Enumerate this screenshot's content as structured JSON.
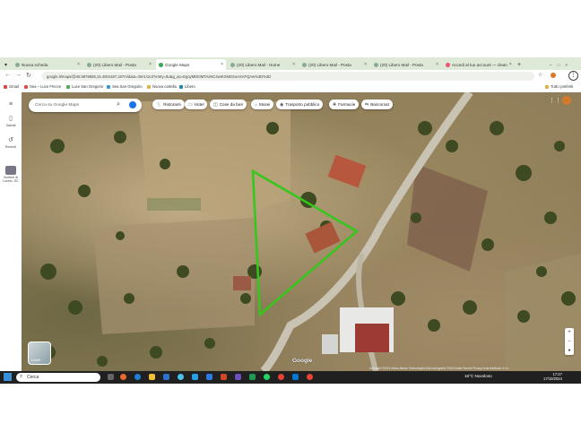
{
  "tabs": [
    {
      "label": "Nuova scheda"
    },
    {
      "label": "(20) Libero Mail - Posta"
    },
    {
      "label": "Google Maps"
    },
    {
      "label": "(20) Libero Mail - Home"
    },
    {
      "label": "(20) Libero Mail - Posta"
    },
    {
      "label": "(20) Libero Mail - Posta"
    },
    {
      "label": "Accedi al tuo account — clean"
    }
  ],
  "address": {
    "url": "google.it/maps/@40.6878686,15.4004187,187m/data=!3m1!1e3?entry=ttu&g_ep=EgoyMDI0MTAxNC4wIKXMDSoASAFQAw%3D%3D"
  },
  "bookmarks": [
    "Gmail",
    "Sea – Luce Frecce",
    "Luce San Gregorio",
    "Sea San Gregorio",
    "Nuova cartella",
    "Libero"
  ],
  "bookmarks_right": "Tutti i preferiti",
  "rail": {
    "saved": "Salvati",
    "recent": "Recenti",
    "place": "Scrittori di Loreto, SC"
  },
  "search": {
    "placeholder": "Cerca su Google Maps"
  },
  "chips": [
    "Ristoranti",
    "Hotel",
    "Cose da fare",
    "Musei",
    "Trasporto pubblico",
    "Farmacie",
    "Bancomat"
  ],
  "map": {
    "layers_label": "Livelli",
    "logo": "Google",
    "attribution": "Immagini ©2024 Airbus,Maxar Technologies,Dati cartografici ©2024  Italia  Termini  Privacy  Invia feedback  10 m"
  },
  "taskbar": {
    "search_placeholder": "Cerca",
    "weather": "16°C  Nuvoloso",
    "time": "17:27",
    "date": "17/10/2024"
  },
  "colors": {
    "boundary": "#33c81a",
    "tabbar": "#dfe9d7",
    "taskbar": "#202020"
  }
}
